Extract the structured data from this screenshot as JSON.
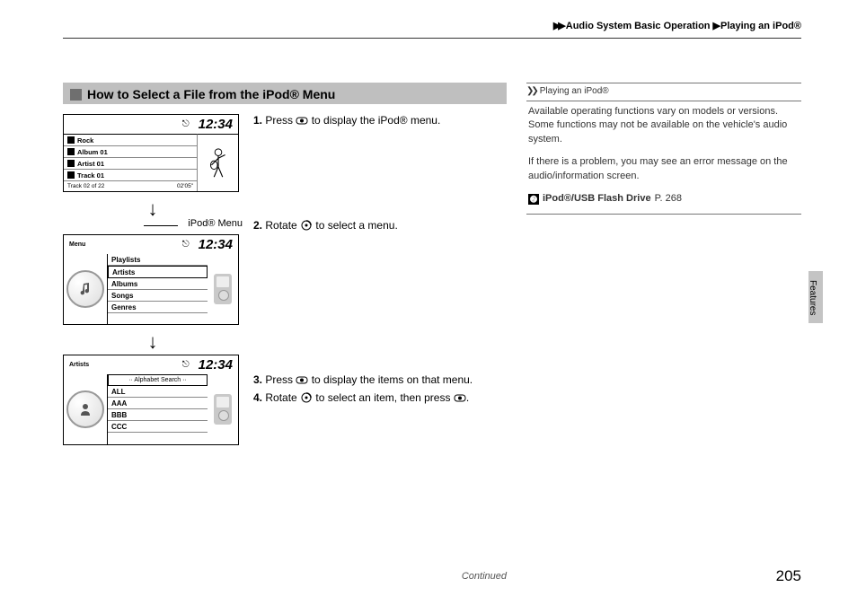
{
  "breadcrumb": {
    "section1": "Audio System Basic Operation",
    "section2": "Playing an iPod®"
  },
  "section_title": "How to Select a File from the iPod® Menu",
  "steps": {
    "s1_lead": "1.",
    "s1a": "Press ",
    "s1b": " to display the iPod® menu.",
    "s2_lead": "2.",
    "s2a": "Rotate ",
    "s2b": " to select a menu.",
    "s3_lead": "3.",
    "s3a": "Press ",
    "s3b": " to display the items on that menu.",
    "s4_lead": "4.",
    "s4a": "Rotate ",
    "s4b": " to select an item, then press ",
    "s4c": "."
  },
  "ipod_menu_label": "iPod® Menu",
  "screen1": {
    "time": "12:34",
    "rows": [
      "Rock",
      "Album 01",
      "Artist 01",
      "Track 01"
    ],
    "footer_left": "Track 02 of 22",
    "footer_right": "02'05\""
  },
  "screen2": {
    "menu_label": "Menu",
    "time": "12:34",
    "items": [
      "Playlists",
      "Artists",
      "Albums",
      "Songs",
      "Genres"
    ],
    "selected_index": 1
  },
  "screen3": {
    "header_label": "Artists",
    "time": "12:34",
    "alpha": "Alphabet Search",
    "items": [
      "ALL",
      "AAA",
      "BBB",
      "CCC"
    ]
  },
  "sidebar": {
    "heading": "Playing an iPod®",
    "p1": "Available operating functions vary on models or versions. Some functions may not be available on the vehicle's audio system.",
    "p2": "If there is a problem, you may see an error message on the audio/information screen.",
    "xref_label": "iPod®/USB Flash Drive",
    "xref_page": "P. 268"
  },
  "side_tab": "Features",
  "continued": "Continued",
  "page_number": "205"
}
